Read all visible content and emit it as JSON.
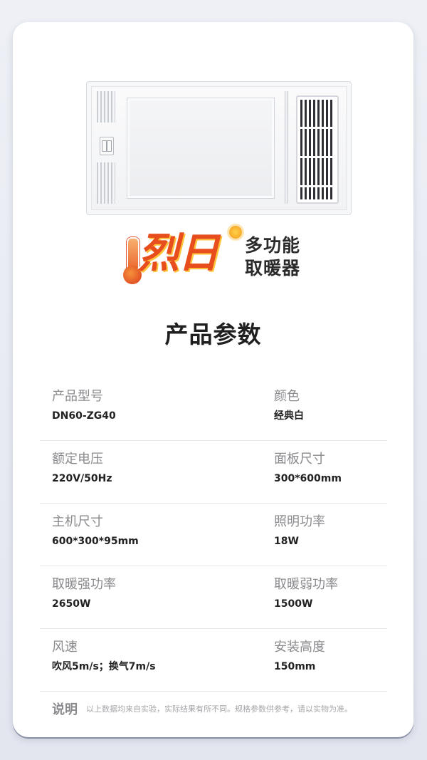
{
  "brand": {
    "name": "烈日",
    "subtitle_line1": "多功能",
    "subtitle_line2": "取暖器"
  },
  "section_title": "产品参数",
  "specs": [
    {
      "left": {
        "label": "产品型号",
        "value": "DN60-ZG40"
      },
      "right": {
        "label": "颜色",
        "value": "经典白"
      }
    },
    {
      "left": {
        "label": "额定电压",
        "value": "220V/50Hz"
      },
      "right": {
        "label": "面板尺寸",
        "value": "300*600mm"
      }
    },
    {
      "left": {
        "label": "主机尺寸",
        "value": "600*300*95mm"
      },
      "right": {
        "label": "照明功率",
        "value": "18W"
      }
    },
    {
      "left": {
        "label": "取暖强功率",
        "value": "2650W"
      },
      "right": {
        "label": "取暖弱功率",
        "value": "1500W"
      }
    },
    {
      "left": {
        "label": "风速",
        "value": "吹风5m/s；换气7m/s"
      },
      "right": {
        "label": "安装高度",
        "value": "150mm"
      }
    }
  ],
  "note": {
    "label": "说明",
    "text": "以上数据均来自实验，实际结果有所不同。规格参数供参考，请以实物为准。"
  },
  "colors": {
    "brand_primary": "#e84d1e",
    "brand_highlight": "#ffc23b",
    "background": "#eef0f6"
  }
}
